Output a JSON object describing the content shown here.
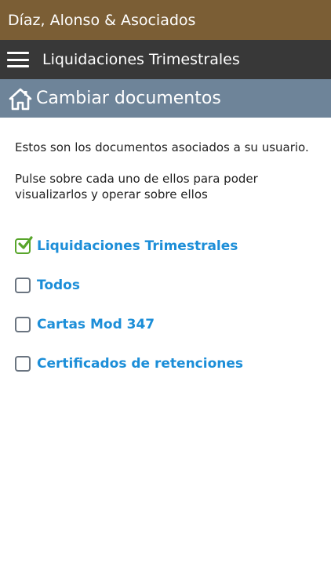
{
  "header": {
    "brand": "Díaz, Alonso & Asociados",
    "nav_title": "Liquidaciones Trimestrales",
    "section_title": "Cambiar documentos"
  },
  "content": {
    "intro": "Estos son los documentos asociados a su usuario.",
    "instruction": "Pulse sobre cada uno de ellos para poder visualizarlos y operar sobre ellos"
  },
  "documents": [
    {
      "label": "Liquidaciones Trimestrales",
      "checked": true
    },
    {
      "label": "Todos",
      "checked": false
    },
    {
      "label": "Cartas Mod 347",
      "checked": false
    },
    {
      "label": "Certificados de retenciones",
      "checked": false
    }
  ],
  "colors": {
    "brand_bar": "#7b5e35",
    "nav_bar": "#383838",
    "section_bar": "#6e8499",
    "link": "#1c8ed8",
    "check": "#58a52b"
  },
  "icons": {
    "menu": "hamburger-menu-icon",
    "section": "home-icon",
    "selected": "checkmark-icon"
  }
}
